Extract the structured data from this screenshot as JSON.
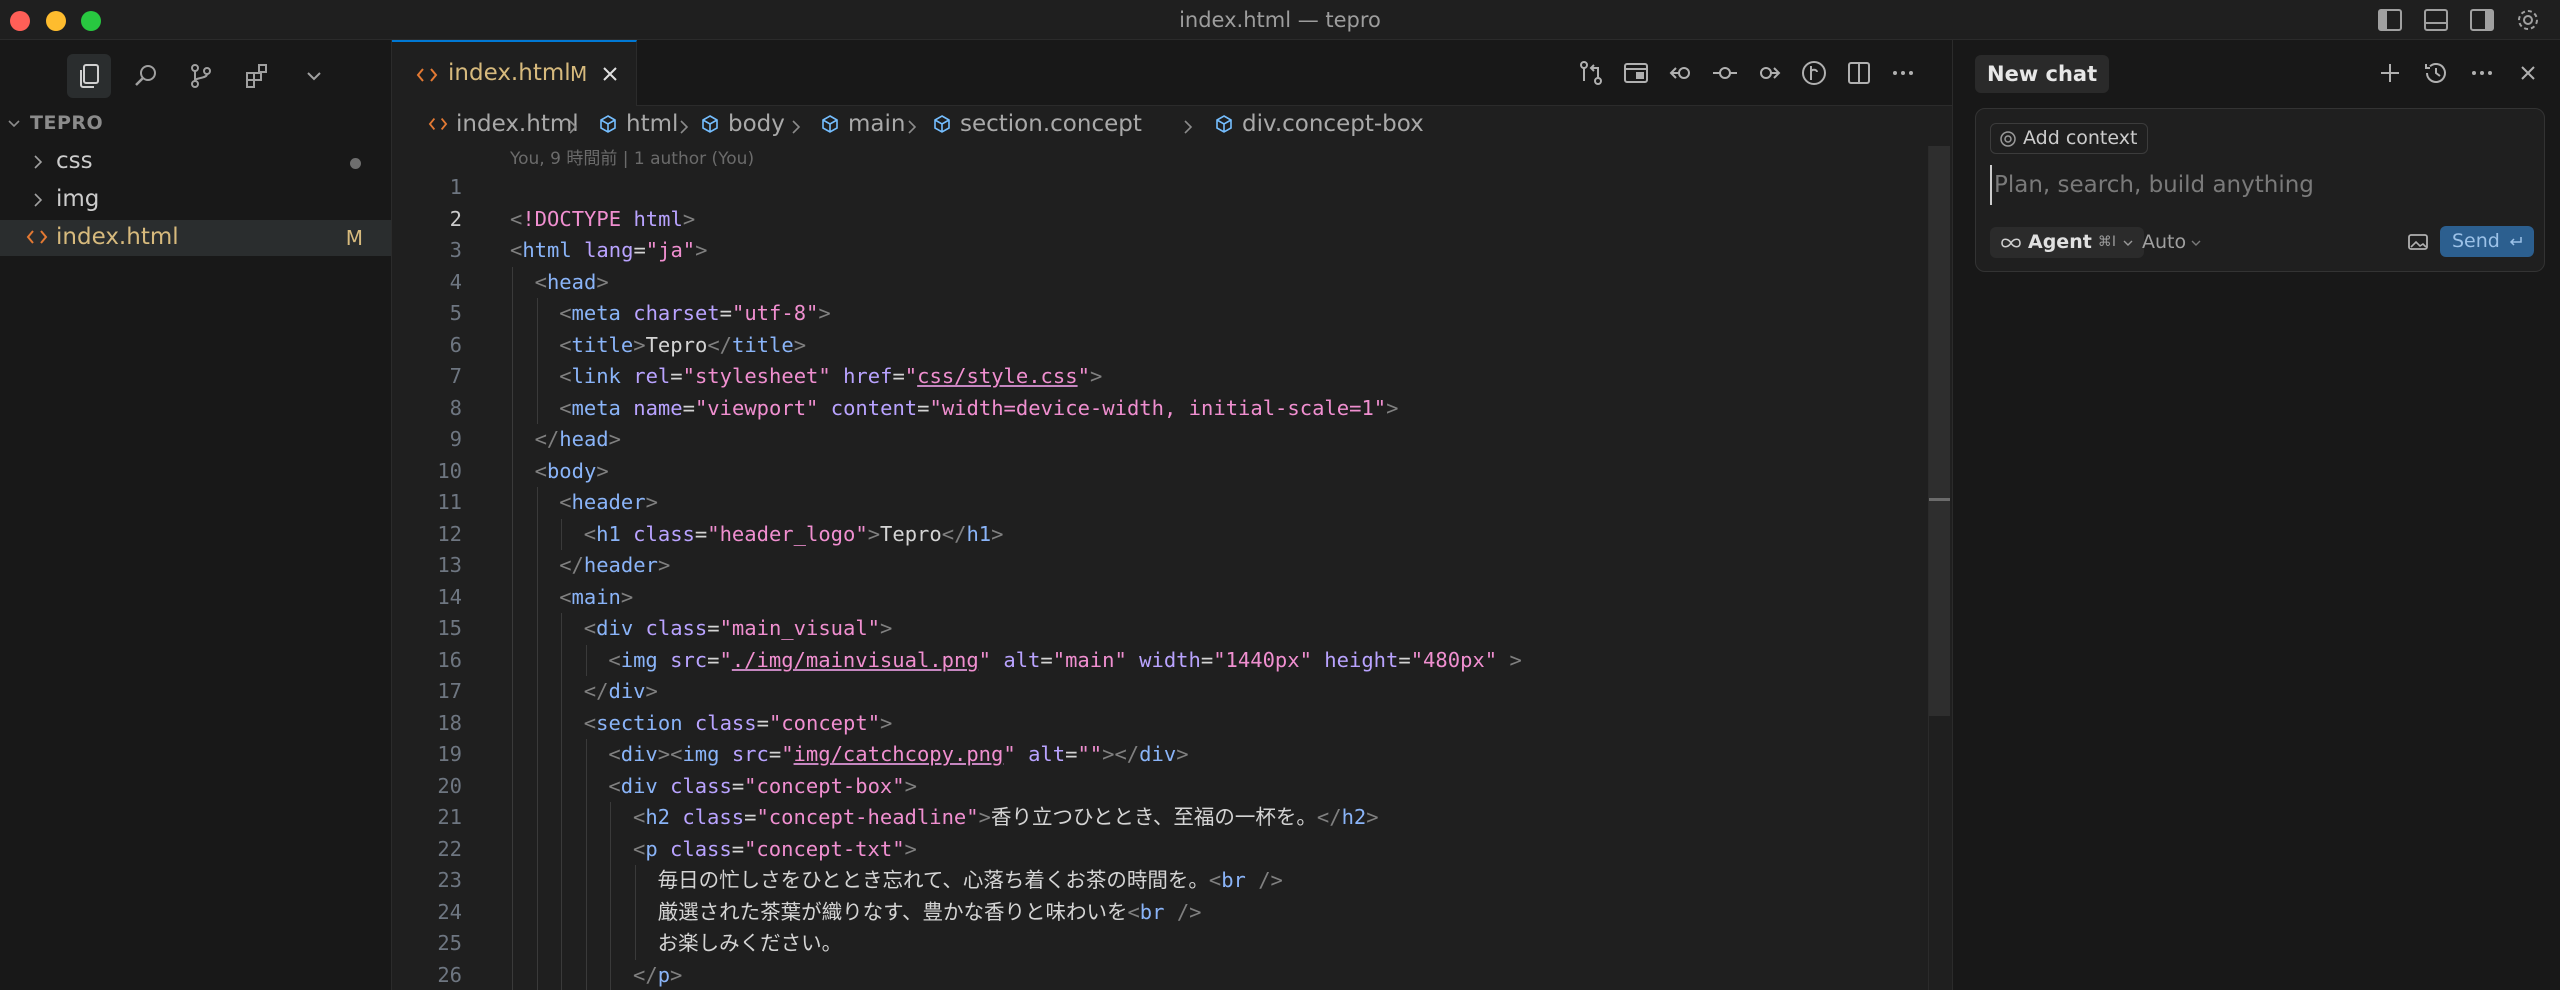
{
  "window": {
    "title": "index.html — tepro"
  },
  "sidebar": {
    "section_title": "TEPRO",
    "items": [
      {
        "label": "css",
        "type": "folder",
        "badge": "dot"
      },
      {
        "label": "img",
        "type": "folder",
        "badge": ""
      },
      {
        "label": "index.html",
        "type": "file",
        "badge": "M"
      }
    ]
  },
  "editor": {
    "tab": {
      "label": "index.html",
      "status": "M"
    },
    "breadcrumb": [
      "index.html",
      "html",
      "body",
      "main",
      "section.concept",
      "div.concept-box"
    ],
    "blame": "You, 9 時間前 | 1 author (You)",
    "current_line": 2,
    "lines": [
      {
        "n": "1",
        "indent": 0,
        "tokens": []
      },
      {
        "n": "2",
        "indent": 0,
        "tokens": [
          [
            "br",
            "<"
          ],
          [
            "doc",
            "!DOCTYPE"
          ],
          [
            "txt",
            " "
          ],
          [
            "attr",
            "html"
          ],
          [
            "br",
            ">"
          ]
        ]
      },
      {
        "n": "3",
        "indent": 0,
        "tokens": [
          [
            "br",
            "<"
          ],
          [
            "tag",
            "html"
          ],
          [
            "txt",
            " "
          ],
          [
            "attr",
            "lang"
          ],
          [
            "txt",
            "="
          ],
          [
            "str",
            "\"ja\""
          ],
          [
            "br",
            ">"
          ]
        ]
      },
      {
        "n": "4",
        "indent": 1,
        "tokens": [
          [
            "br",
            "<"
          ],
          [
            "tag",
            "head"
          ],
          [
            "br",
            ">"
          ]
        ]
      },
      {
        "n": "5",
        "indent": 2,
        "tokens": [
          [
            "br",
            "<"
          ],
          [
            "tag",
            "meta"
          ],
          [
            "txt",
            " "
          ],
          [
            "attr",
            "charset"
          ],
          [
            "txt",
            "="
          ],
          [
            "str",
            "\"utf-8\""
          ],
          [
            "br",
            ">"
          ]
        ]
      },
      {
        "n": "6",
        "indent": 2,
        "tokens": [
          [
            "br",
            "<"
          ],
          [
            "tag",
            "title"
          ],
          [
            "br",
            ">"
          ],
          [
            "txt",
            "Tepro"
          ],
          [
            "br",
            "</"
          ],
          [
            "tag",
            "title"
          ],
          [
            "br",
            ">"
          ]
        ]
      },
      {
        "n": "7",
        "indent": 2,
        "tokens": [
          [
            "br",
            "<"
          ],
          [
            "tag",
            "link"
          ],
          [
            "txt",
            " "
          ],
          [
            "attr",
            "rel"
          ],
          [
            "txt",
            "="
          ],
          [
            "str",
            "\"stylesheet\""
          ],
          [
            "txt",
            " "
          ],
          [
            "attr",
            "href"
          ],
          [
            "txt",
            "="
          ],
          [
            "str",
            "\""
          ],
          [
            "link",
            "css/style.css"
          ],
          [
            "str",
            "\""
          ],
          [
            "br",
            ">"
          ]
        ]
      },
      {
        "n": "8",
        "indent": 2,
        "tokens": [
          [
            "br",
            "<"
          ],
          [
            "tag",
            "meta"
          ],
          [
            "txt",
            " "
          ],
          [
            "attr",
            "name"
          ],
          [
            "txt",
            "="
          ],
          [
            "str",
            "\"viewport\""
          ],
          [
            "txt",
            " "
          ],
          [
            "attr",
            "content"
          ],
          [
            "txt",
            "="
          ],
          [
            "str",
            "\"width=device-width, initial-scale=1\""
          ],
          [
            "br",
            ">"
          ]
        ]
      },
      {
        "n": "9",
        "indent": 1,
        "tokens": [
          [
            "br",
            "</"
          ],
          [
            "tag",
            "head"
          ],
          [
            "br",
            ">"
          ]
        ]
      },
      {
        "n": "10",
        "indent": 1,
        "tokens": [
          [
            "br",
            "<"
          ],
          [
            "tag",
            "body"
          ],
          [
            "br",
            ">"
          ]
        ]
      },
      {
        "n": "11",
        "indent": 2,
        "tokens": [
          [
            "br",
            "<"
          ],
          [
            "tag",
            "header"
          ],
          [
            "br",
            ">"
          ]
        ]
      },
      {
        "n": "12",
        "indent": 3,
        "tokens": [
          [
            "br",
            "<"
          ],
          [
            "tag",
            "h1"
          ],
          [
            "txt",
            " "
          ],
          [
            "attr",
            "class"
          ],
          [
            "txt",
            "="
          ],
          [
            "str",
            "\"header_logo\""
          ],
          [
            "br",
            ">"
          ],
          [
            "txt",
            "Tepro"
          ],
          [
            "br",
            "</"
          ],
          [
            "tag",
            "h1"
          ],
          [
            "br",
            ">"
          ]
        ]
      },
      {
        "n": "13",
        "indent": 2,
        "tokens": [
          [
            "br",
            "</"
          ],
          [
            "tag",
            "header"
          ],
          [
            "br",
            ">"
          ]
        ]
      },
      {
        "n": "14",
        "indent": 2,
        "tokens": [
          [
            "br",
            "<"
          ],
          [
            "tag",
            "main"
          ],
          [
            "br",
            ">"
          ]
        ]
      },
      {
        "n": "15",
        "indent": 3,
        "tokens": [
          [
            "br",
            "<"
          ],
          [
            "tag",
            "div"
          ],
          [
            "txt",
            " "
          ],
          [
            "attr",
            "class"
          ],
          [
            "txt",
            "="
          ],
          [
            "str",
            "\"main_visual\""
          ],
          [
            "br",
            ">"
          ]
        ]
      },
      {
        "n": "16",
        "indent": 4,
        "tokens": [
          [
            "br",
            "<"
          ],
          [
            "tag",
            "img"
          ],
          [
            "txt",
            " "
          ],
          [
            "attr",
            "src"
          ],
          [
            "txt",
            "="
          ],
          [
            "str",
            "\""
          ],
          [
            "link",
            "./img/mainvisual.png"
          ],
          [
            "str",
            "\""
          ],
          [
            "txt",
            " "
          ],
          [
            "attr",
            "alt"
          ],
          [
            "txt",
            "="
          ],
          [
            "str",
            "\"main\""
          ],
          [
            "txt",
            " "
          ],
          [
            "attr",
            "width"
          ],
          [
            "txt",
            "="
          ],
          [
            "str",
            "\"1440px\""
          ],
          [
            "txt",
            " "
          ],
          [
            "attr",
            "height"
          ],
          [
            "txt",
            "="
          ],
          [
            "str",
            "\"480px\""
          ],
          [
            "txt",
            " "
          ],
          [
            "br",
            ">"
          ]
        ]
      },
      {
        "n": "17",
        "indent": 3,
        "tokens": [
          [
            "br",
            "</"
          ],
          [
            "tag",
            "div"
          ],
          [
            "br",
            ">"
          ]
        ]
      },
      {
        "n": "18",
        "indent": 3,
        "tokens": [
          [
            "br",
            "<"
          ],
          [
            "tag",
            "section"
          ],
          [
            "txt",
            " "
          ],
          [
            "attr",
            "class"
          ],
          [
            "txt",
            "="
          ],
          [
            "str",
            "\"concept\""
          ],
          [
            "br",
            ">"
          ]
        ]
      },
      {
        "n": "19",
        "indent": 4,
        "tokens": [
          [
            "br",
            "<"
          ],
          [
            "tag",
            "div"
          ],
          [
            "br",
            "><"
          ],
          [
            "tag",
            "img"
          ],
          [
            "txt",
            " "
          ],
          [
            "attr",
            "src"
          ],
          [
            "txt",
            "="
          ],
          [
            "str",
            "\""
          ],
          [
            "link",
            "img/catchcopy.png"
          ],
          [
            "str",
            "\""
          ],
          [
            "txt",
            " "
          ],
          [
            "attr",
            "alt"
          ],
          [
            "txt",
            "="
          ],
          [
            "str",
            "\"\""
          ],
          [
            "br",
            "></"
          ],
          [
            "tag",
            "div"
          ],
          [
            "br",
            ">"
          ]
        ]
      },
      {
        "n": "20",
        "indent": 4,
        "tokens": [
          [
            "br",
            "<"
          ],
          [
            "tag",
            "div"
          ],
          [
            "txt",
            " "
          ],
          [
            "attr",
            "class"
          ],
          [
            "txt",
            "="
          ],
          [
            "str",
            "\"concept-box\""
          ],
          [
            "br",
            ">"
          ]
        ]
      },
      {
        "n": "21",
        "indent": 5,
        "tokens": [
          [
            "br",
            "<"
          ],
          [
            "tag",
            "h2"
          ],
          [
            "txt",
            " "
          ],
          [
            "attr",
            "class"
          ],
          [
            "txt",
            "="
          ],
          [
            "str",
            "\"concept-headline\""
          ],
          [
            "br",
            ">"
          ],
          [
            "txt",
            "香り立つひととき、至福の一杯を。"
          ],
          [
            "br",
            "</"
          ],
          [
            "tag",
            "h2"
          ],
          [
            "br",
            ">"
          ]
        ]
      },
      {
        "n": "22",
        "indent": 5,
        "tokens": [
          [
            "br",
            "<"
          ],
          [
            "tag",
            "p"
          ],
          [
            "txt",
            " "
          ],
          [
            "attr",
            "class"
          ],
          [
            "txt",
            "="
          ],
          [
            "str",
            "\"concept-txt\""
          ],
          [
            "br",
            ">"
          ]
        ]
      },
      {
        "n": "23",
        "indent": 6,
        "tokens": [
          [
            "txt",
            "毎日の忙しさをひととき忘れて、心落ち着くお茶の時間を。"
          ],
          [
            "br",
            "<"
          ],
          [
            "tag",
            "br"
          ],
          [
            "txt",
            " "
          ],
          [
            "br",
            "/>"
          ]
        ]
      },
      {
        "n": "24",
        "indent": 6,
        "tokens": [
          [
            "txt",
            "厳選された茶葉が織りなす、豊かな香りと味わいを"
          ],
          [
            "br",
            "<"
          ],
          [
            "tag",
            "br"
          ],
          [
            "txt",
            " "
          ],
          [
            "br",
            "/>"
          ]
        ]
      },
      {
        "n": "25",
        "indent": 6,
        "tokens": [
          [
            "txt",
            "お楽しみください。"
          ]
        ]
      },
      {
        "n": "26",
        "indent": 5,
        "tokens": [
          [
            "br",
            "</"
          ],
          [
            "tag",
            "p"
          ],
          [
            "br",
            ">"
          ]
        ]
      }
    ]
  },
  "chat": {
    "tab_label": "New chat",
    "add_context_label": "Add context",
    "input_placeholder": "Plan, search, build anything",
    "agent_label": "Agent",
    "agent_shortcut": "⌘I",
    "model_label": "Auto",
    "send_label": "Send"
  },
  "colors": {
    "accent": "#0078d4",
    "modified": "#d7ba7d",
    "send": "#2c5f8f"
  }
}
